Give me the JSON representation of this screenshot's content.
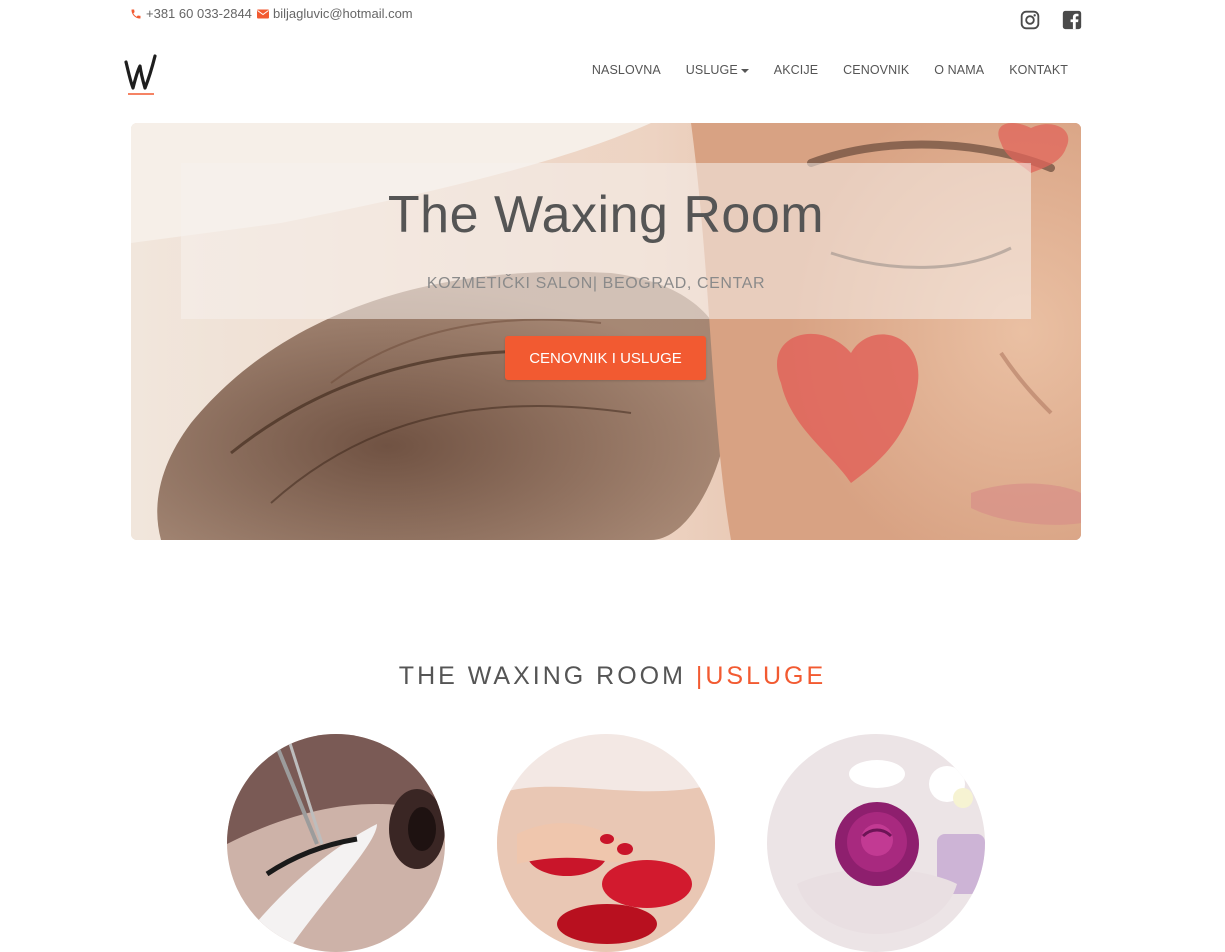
{
  "topbar": {
    "phone": "+381 60 033-2844",
    "email": "biljagluvic@hotmail.com",
    "icons": [
      "phone-icon",
      "envelope-icon",
      "instagram-icon",
      "facebook-icon"
    ]
  },
  "nav": {
    "logo_letter": "W",
    "items": [
      {
        "label": "NASLOVNA"
      },
      {
        "label": "USLUGE",
        "has_dropdown": true
      },
      {
        "label": "AKCIJE"
      },
      {
        "label": "CENOVNIK"
      },
      {
        "label": "O NAMA"
      },
      {
        "label": "KONTAKT"
      }
    ]
  },
  "hero": {
    "title": "The Waxing Room",
    "subtitle": "KOZMETIČKI SALON| BEOGRAD, CENTAR",
    "button_label": "CENOVNIK I USLUGE"
  },
  "services": {
    "title_main": "THE WAXING ROOM ",
    "title_accent": "|USLUGE"
  },
  "colors": {
    "accent": "#f25a31",
    "text": "#555555",
    "muted": "#8a8a8a"
  }
}
